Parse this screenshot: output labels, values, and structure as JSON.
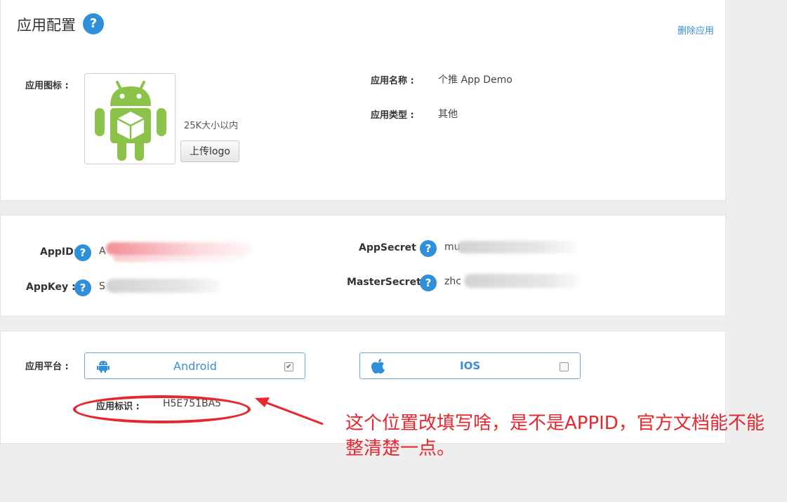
{
  "header": {
    "title": "应用配置",
    "help_glyph": "?",
    "delete_link": "删除应用"
  },
  "basic": {
    "icon_label": "应用图标 :",
    "size_hint": "25K大小以内",
    "upload_button": "上传logo",
    "name_label": "应用名称 :",
    "name_value": "个推 App Demo",
    "type_label": "应用类型 :",
    "type_value": "其他"
  },
  "keys": {
    "appid_label": "AppID:",
    "appid_value": "A",
    "appkey_label": "AppKey :",
    "appkey_value": "S",
    "appsecret_label": "AppSecret :",
    "appsecret_value": "mu",
    "mastersecret_label": "MasterSecret :",
    "mastersecret_value": "zhc"
  },
  "platform": {
    "label": "应用平台 :",
    "android_label": "Android",
    "android_checked": "✔",
    "ios_label": "IOS",
    "id_label": "应用标识 :",
    "id_value": "H5E751BA5"
  },
  "annotation": {
    "text": "这个位置改填写啥，是不是APPID，官方文档能不能整清楚一点。"
  },
  "colors": {
    "accent": "#2f8fd8",
    "annotation": "#e8262e",
    "android_green": "#8bc34a"
  },
  "icons": [
    "help-icon",
    "android-icon",
    "apple-icon",
    "checkbox-icon"
  ]
}
